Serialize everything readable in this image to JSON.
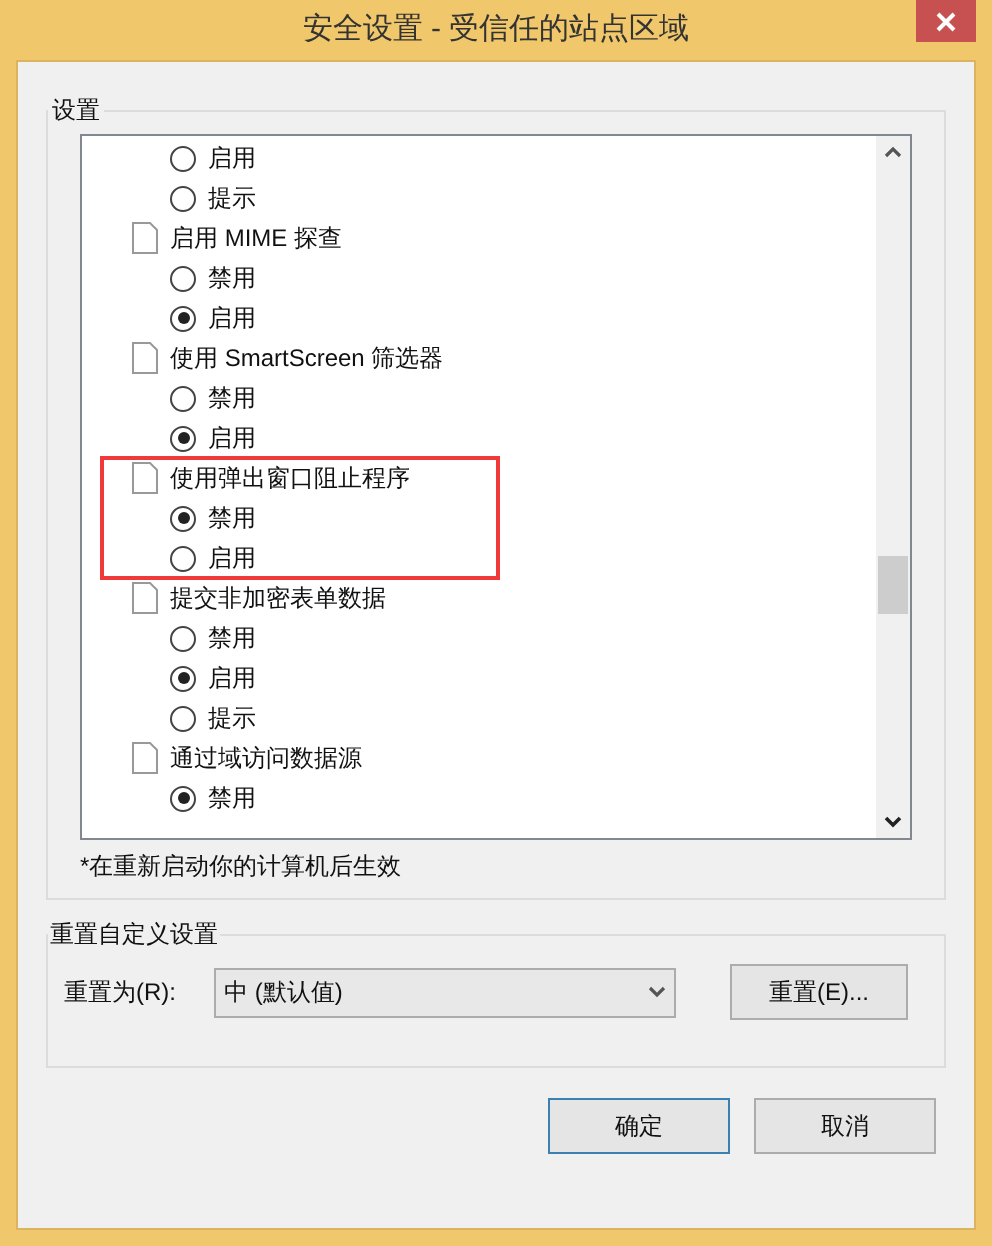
{
  "window": {
    "title": "安全设置 - 受信任的站点区域"
  },
  "settings_group": {
    "title": "设置",
    "items": [
      {
        "kind": "radio",
        "label": "启用",
        "selected": false
      },
      {
        "kind": "radio",
        "label": "提示",
        "selected": false
      },
      {
        "kind": "setting",
        "label": "启用 MIME 探查",
        "highlighted": false,
        "children": [
          {
            "kind": "radio",
            "label": "禁用",
            "selected": false
          },
          {
            "kind": "radio",
            "label": "启用",
            "selected": true
          }
        ]
      },
      {
        "kind": "setting",
        "label": "使用 SmartScreen 筛选器",
        "highlighted": false,
        "children": [
          {
            "kind": "radio",
            "label": "禁用",
            "selected": false
          },
          {
            "kind": "radio",
            "label": "启用",
            "selected": true
          }
        ]
      },
      {
        "kind": "setting",
        "label": "使用弹出窗口阻止程序",
        "highlighted": true,
        "children": [
          {
            "kind": "radio",
            "label": "禁用",
            "selected": true
          },
          {
            "kind": "radio",
            "label": "启用",
            "selected": false
          }
        ]
      },
      {
        "kind": "setting",
        "label": "提交非加密表单数据",
        "highlighted": false,
        "children": [
          {
            "kind": "radio",
            "label": "禁用",
            "selected": false
          },
          {
            "kind": "radio",
            "label": "启用",
            "selected": true
          },
          {
            "kind": "radio",
            "label": "提示",
            "selected": false
          }
        ]
      },
      {
        "kind": "setting",
        "label": "通过域访问数据源",
        "highlighted": false,
        "children": [
          {
            "kind": "radio",
            "label": "禁用",
            "selected": true
          }
        ]
      }
    ],
    "note": "*在重新启动你的计算机后生效"
  },
  "reset_group": {
    "title": "重置自定义设置",
    "label": "重置为(R):",
    "dropdown_value": "中 (默认值)",
    "button": "重置(E)..."
  },
  "buttons": [
    {
      "label": "确定",
      "default": true
    },
    {
      "label": "取消",
      "default": false
    }
  ]
}
